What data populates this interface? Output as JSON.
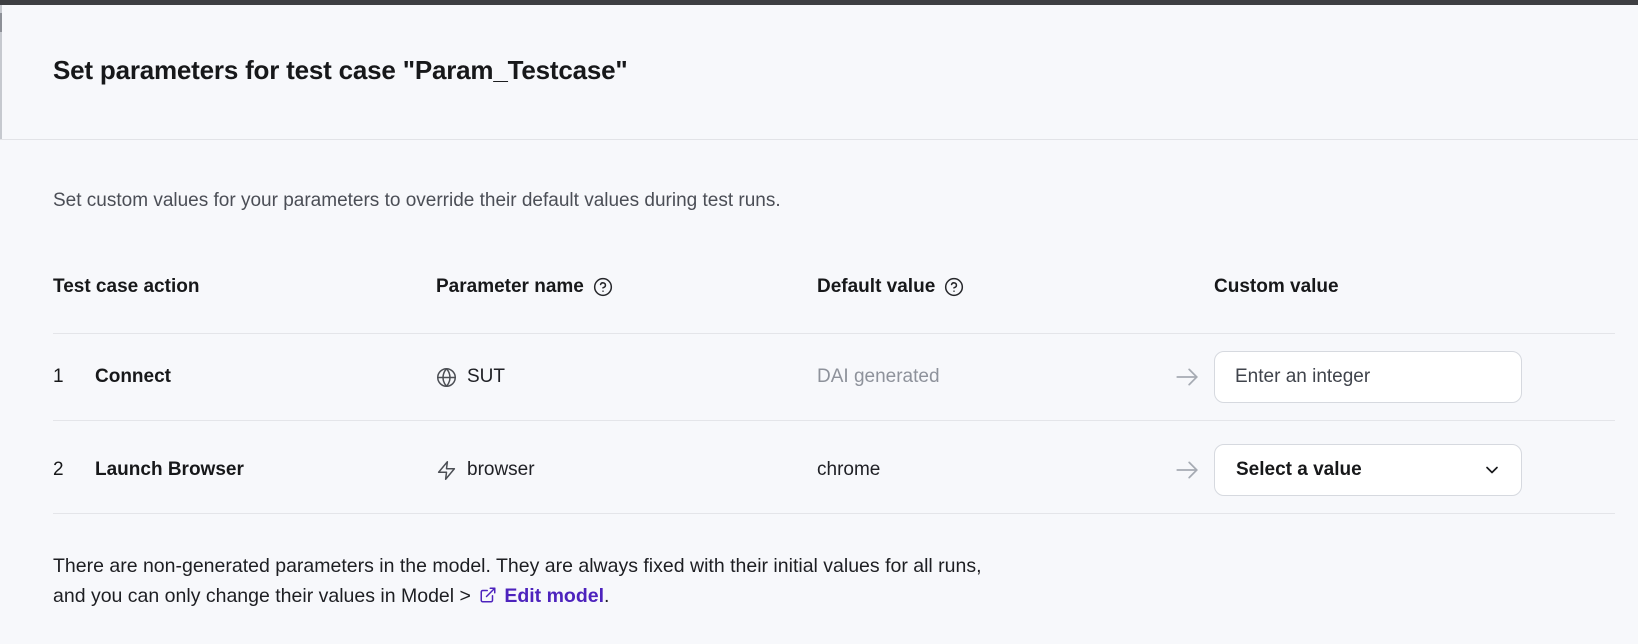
{
  "window": {
    "topbar_color": "#3e3f42",
    "background_color": "#f7f8fb",
    "accent_link_color": "#4d23bd"
  },
  "header": {
    "title": "Set parameters for test case \"Param_Testcase\""
  },
  "intro": {
    "text": "Set custom values for your parameters to override their default values during test runs."
  },
  "table": {
    "columns": [
      {
        "label": "Test case action",
        "help_icon": false
      },
      {
        "label": "Parameter name",
        "help_icon": true
      },
      {
        "label": "Default value",
        "help_icon": true
      },
      {
        "label": "Custom value",
        "help_icon": false
      }
    ],
    "rows": [
      {
        "index": "1",
        "action": "Connect",
        "param_icon": "globe-icon",
        "param_name": "SUT",
        "default_value": "DAI generated",
        "default_is_muted": true,
        "custom_control": "text-input",
        "control_placeholder": "Enter an integer"
      },
      {
        "index": "2",
        "action": "Launch Browser",
        "param_icon": "zap-icon",
        "param_name": "browser",
        "default_value": "chrome",
        "default_is_muted": false,
        "custom_control": "select",
        "control_placeholder": "Select a value"
      }
    ]
  },
  "footer": {
    "line1": "There are non-generated parameters in the model. They are always fixed with their initial values for all runs,",
    "line2_prefix": "and you can only change their values in Model > ",
    "link_label": "Edit model",
    "line2_suffix": "."
  }
}
